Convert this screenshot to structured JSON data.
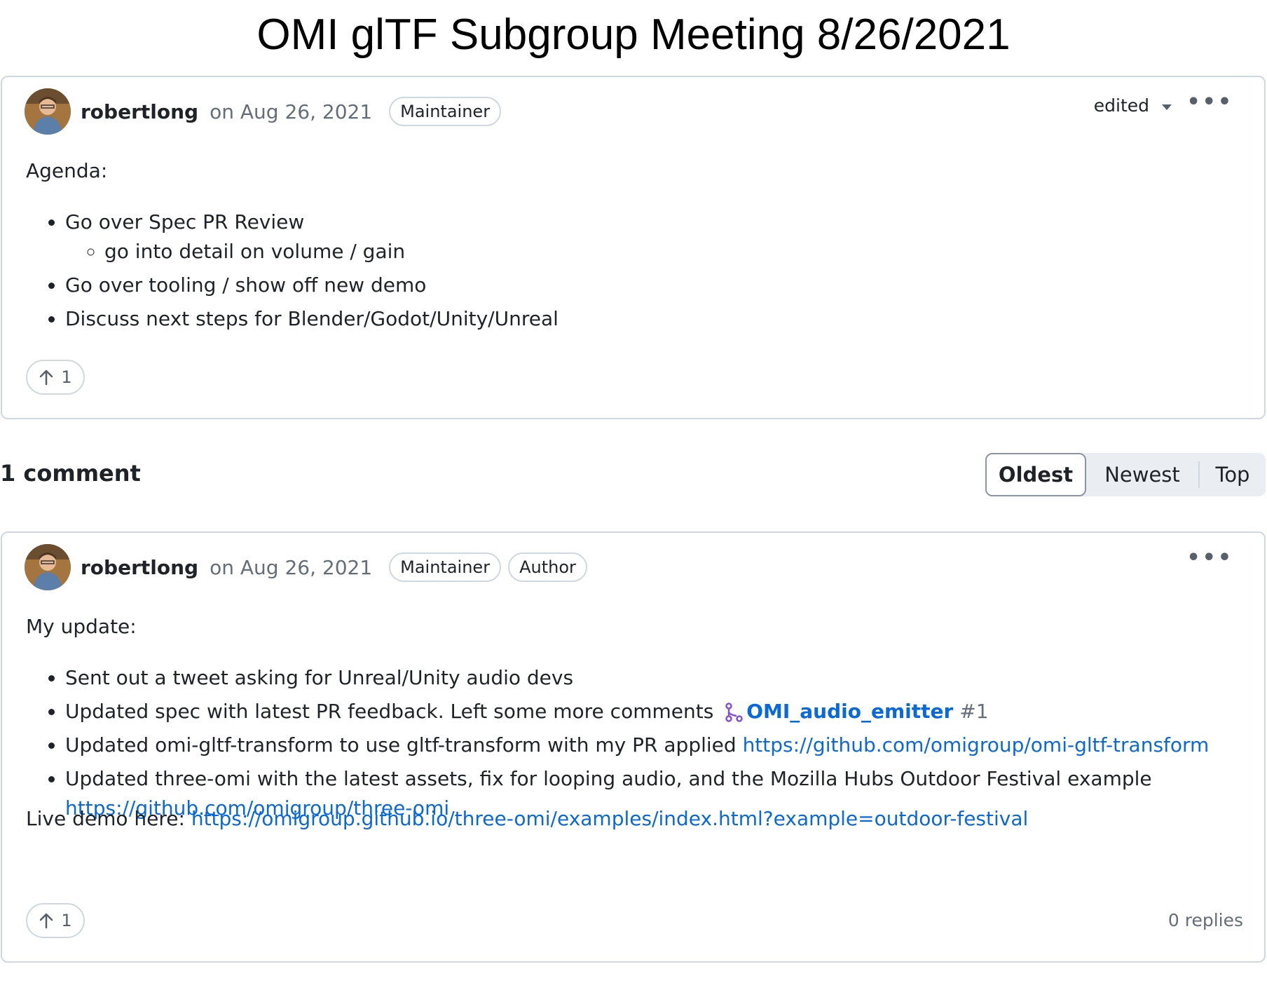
{
  "page_title": "OMI glTF Subgroup Meeting 8/26/2021",
  "post": {
    "author": "robertlong",
    "date": "on Aug 26, 2021",
    "badges": [
      "Maintainer"
    ],
    "edited_label": "edited",
    "intro": "Agenda:",
    "items": [
      "Go over Spec PR Review",
      "go into detail on volume / gain",
      "Go over tooling / show off new demo",
      "Discuss next steps for Blender/Godot/Unity/Unreal"
    ],
    "upvotes": "1"
  },
  "comments_header": {
    "count_label": "1 comment",
    "sort_options": [
      "Oldest",
      "Newest",
      "Top"
    ],
    "selected_sort": "Oldest"
  },
  "comment": {
    "author": "robertlong",
    "date": "on Aug 26, 2021",
    "badges": [
      "Maintainer",
      "Author"
    ],
    "intro": "My update:",
    "item1": "Sent out a tweet asking for Unreal/Unity audio devs",
    "item2_text": "Updated spec with latest PR feedback. Left some more comments",
    "item2_pr_title": "OMI_audio_emitter",
    "item2_pr_number": "#1",
    "item3_text": "Updated omi-gltf-transform to use gltf-transform with my PR applied",
    "item3_link": "https://github.com/omigroup/omi-gltf-transform",
    "item4_text": "Updated three-omi with the latest assets, fix for looping audio, and the Mozilla Hubs Outdoor Festival example",
    "item4_link": "https://github.com/omigroup/three-omi",
    "demo_label": "Live demo here:",
    "demo_link": "https://omigroup.github.io/three-omi/examples/index.html?example=outdoor-festival",
    "upvotes": "1",
    "replies": "0 replies"
  },
  "icons": {
    "upvote": "arrow-up-icon",
    "more": "kebab-horizontal-icon",
    "pr": "git-pull-request-icon",
    "caret": "triangle-down-icon"
  },
  "colors": {
    "link": "#0969da",
    "pr_icon": "#8250df",
    "border": "#d0d7de"
  }
}
